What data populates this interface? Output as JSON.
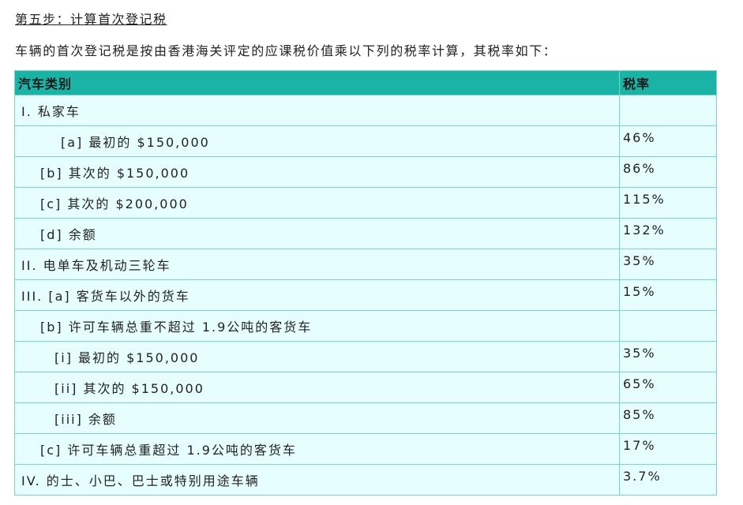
{
  "heading": "第五步：计算首次登记税",
  "intro": "车辆的首次登记税是按由香港海关评定的应课税价值乘以下列的税率计算，其税率如下：",
  "table": {
    "headers": {
      "category": "汽车类别",
      "rate": "税率"
    },
    "rows": [
      {
        "category": "I. 私家车",
        "rate": "",
        "indent": 0
      },
      {
        "category": "[a] 最初的 $150,000",
        "rate": "46%",
        "indent": 3
      },
      {
        "category": "[b] 其次的 $150,000",
        "rate": "86%",
        "indent": 1
      },
      {
        "category": "[c] 其次的 $200,000",
        "rate": "115%",
        "indent": 1
      },
      {
        "category": "[d] 余额",
        "rate": "132%",
        "indent": 1
      },
      {
        "category": "II. 电单车及机动三轮车",
        "rate": "35%",
        "indent": 0
      },
      {
        "category": "III. [a] 客货车以外的货车",
        "rate": "15%",
        "indent": 0
      },
      {
        "category": "[b] 许可车辆总重不超过 1.9公吨的客货车",
        "rate": "",
        "indent": 1
      },
      {
        "category": "[i] 最初的 $150,000",
        "rate": "35%",
        "indent": 2
      },
      {
        "category": "[ii] 其次的 $150,000",
        "rate": "65%",
        "indent": 2
      },
      {
        "category": "[iii] 余额",
        "rate": "85%",
        "indent": 2
      },
      {
        "category": "[c] 许可车辆总重超过 1.9公吨的客货车",
        "rate": "17%",
        "indent": 1
      },
      {
        "category": "IV. 的士、小巴、巴士或特别用途车辆",
        "rate": "3.7%",
        "indent": 0
      }
    ]
  },
  "colors": {
    "header_bg": "#1ab3a6",
    "cell_bg": "#e6fefe",
    "border": "#7ed3c9"
  }
}
